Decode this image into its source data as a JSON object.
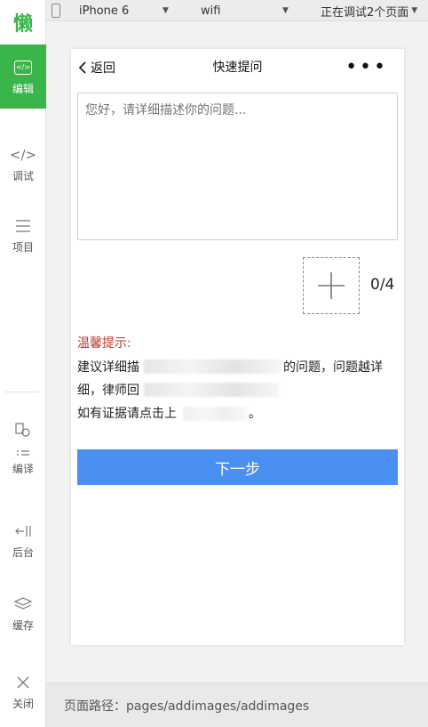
{
  "sidebar": {
    "logo_text": "懒",
    "items": [
      {
        "label": "编辑",
        "icon": "code-icon"
      },
      {
        "label": "调试",
        "icon": "debug-icon"
      },
      {
        "label": "项目",
        "icon": "menu-icon"
      },
      {
        "label": "编译",
        "icon": "compile-icon"
      },
      {
        "label": "后台",
        "icon": "background-icon"
      },
      {
        "label": "缓存",
        "icon": "layers-icon"
      },
      {
        "label": "关闭",
        "icon": "close-icon"
      }
    ]
  },
  "toolbar": {
    "device": "iPhone 6",
    "network": "wifi",
    "debug_status": "正在调试2个页面"
  },
  "page": {
    "back_label": "返回",
    "title": "快速提问",
    "more": "•••",
    "textarea_placeholder": "您好，请详细描述你的问题...",
    "counter": "0/4",
    "tips_title": "温馨提示:",
    "tips_line1_start": "建议详细描",
    "tips_line1_end": "的问题，问题越详",
    "tips_line2_start": "细，律师回",
    "tips_line3_start": "如有证据请点击上",
    "tips_line3_end": "。",
    "next_button": "下一步"
  },
  "footer": {
    "path": "页面路径：pages/addimages/addimages"
  },
  "colors": {
    "accent_green": "#39b54a",
    "button_blue": "#4a90f0",
    "tips_red": "#c0392b"
  }
}
